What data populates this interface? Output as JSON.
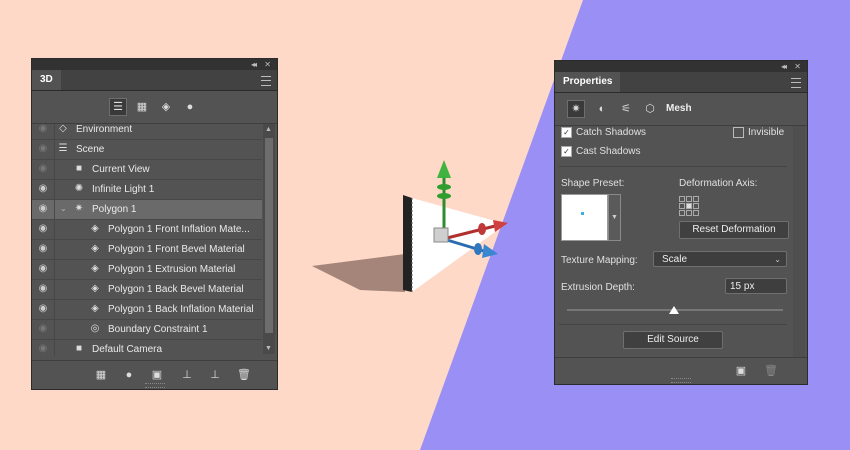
{
  "colors": {
    "bg_left": "#ffd9c8",
    "bg_right": "#998ff5",
    "panel": "#535353",
    "selected": "#6a6a6a"
  },
  "panel3d": {
    "tab": "3D",
    "filter_icons": [
      "scene-filter-icon",
      "mesh-filter-icon",
      "material-filter-icon",
      "light-filter-icon"
    ],
    "rows": [
      {
        "label": "Environment",
        "icon": "environment-icon",
        "indent": 0
      },
      {
        "label": "Scene",
        "icon": "scene-icon",
        "indent": 0
      },
      {
        "label": "Current View",
        "icon": "camera-icon",
        "indent": 1
      },
      {
        "label": "Infinite Light 1",
        "icon": "light-icon",
        "indent": 1
      },
      {
        "label": "Polygon 1",
        "icon": "mesh-icon",
        "indent": 1
      },
      {
        "label": "Polygon 1 Front Inflation Mate...",
        "icon": "material-icon",
        "indent": 2
      },
      {
        "label": "Polygon 1 Front Bevel Material",
        "icon": "material-icon",
        "indent": 2
      },
      {
        "label": "Polygon 1 Extrusion Material",
        "icon": "material-icon",
        "indent": 2
      },
      {
        "label": "Polygon 1 Back Bevel Material",
        "icon": "material-icon",
        "indent": 2
      },
      {
        "label": "Polygon 1 Back Inflation Material",
        "icon": "material-icon",
        "indent": 2
      },
      {
        "label": "Boundary Constraint 1",
        "icon": "constraint-icon",
        "indent": 2
      },
      {
        "label": "Default Camera",
        "icon": "camera-icon",
        "indent": 1
      }
    ],
    "bottom_icons": [
      "add-mesh-icon",
      "add-light-icon",
      "render-icon",
      "ground-icon",
      "move-to-ground-icon",
      "trash-icon"
    ]
  },
  "properties": {
    "tab": "Properties",
    "mode": "Mesh",
    "catch_shadows": "Catch Shadows",
    "invisible": "Invisible",
    "cast_shadows": "Cast Shadows",
    "shape_preset": "Shape Preset:",
    "deformation_axis": "Deformation Axis:",
    "reset_deformation": "Reset Deformation",
    "texture_mapping_label": "Texture Mapping:",
    "texture_mapping_value": "Scale",
    "extrusion_depth_label": "Extrusion Depth:",
    "extrusion_depth_value": "15 px",
    "edit_source": "Edit Source"
  }
}
